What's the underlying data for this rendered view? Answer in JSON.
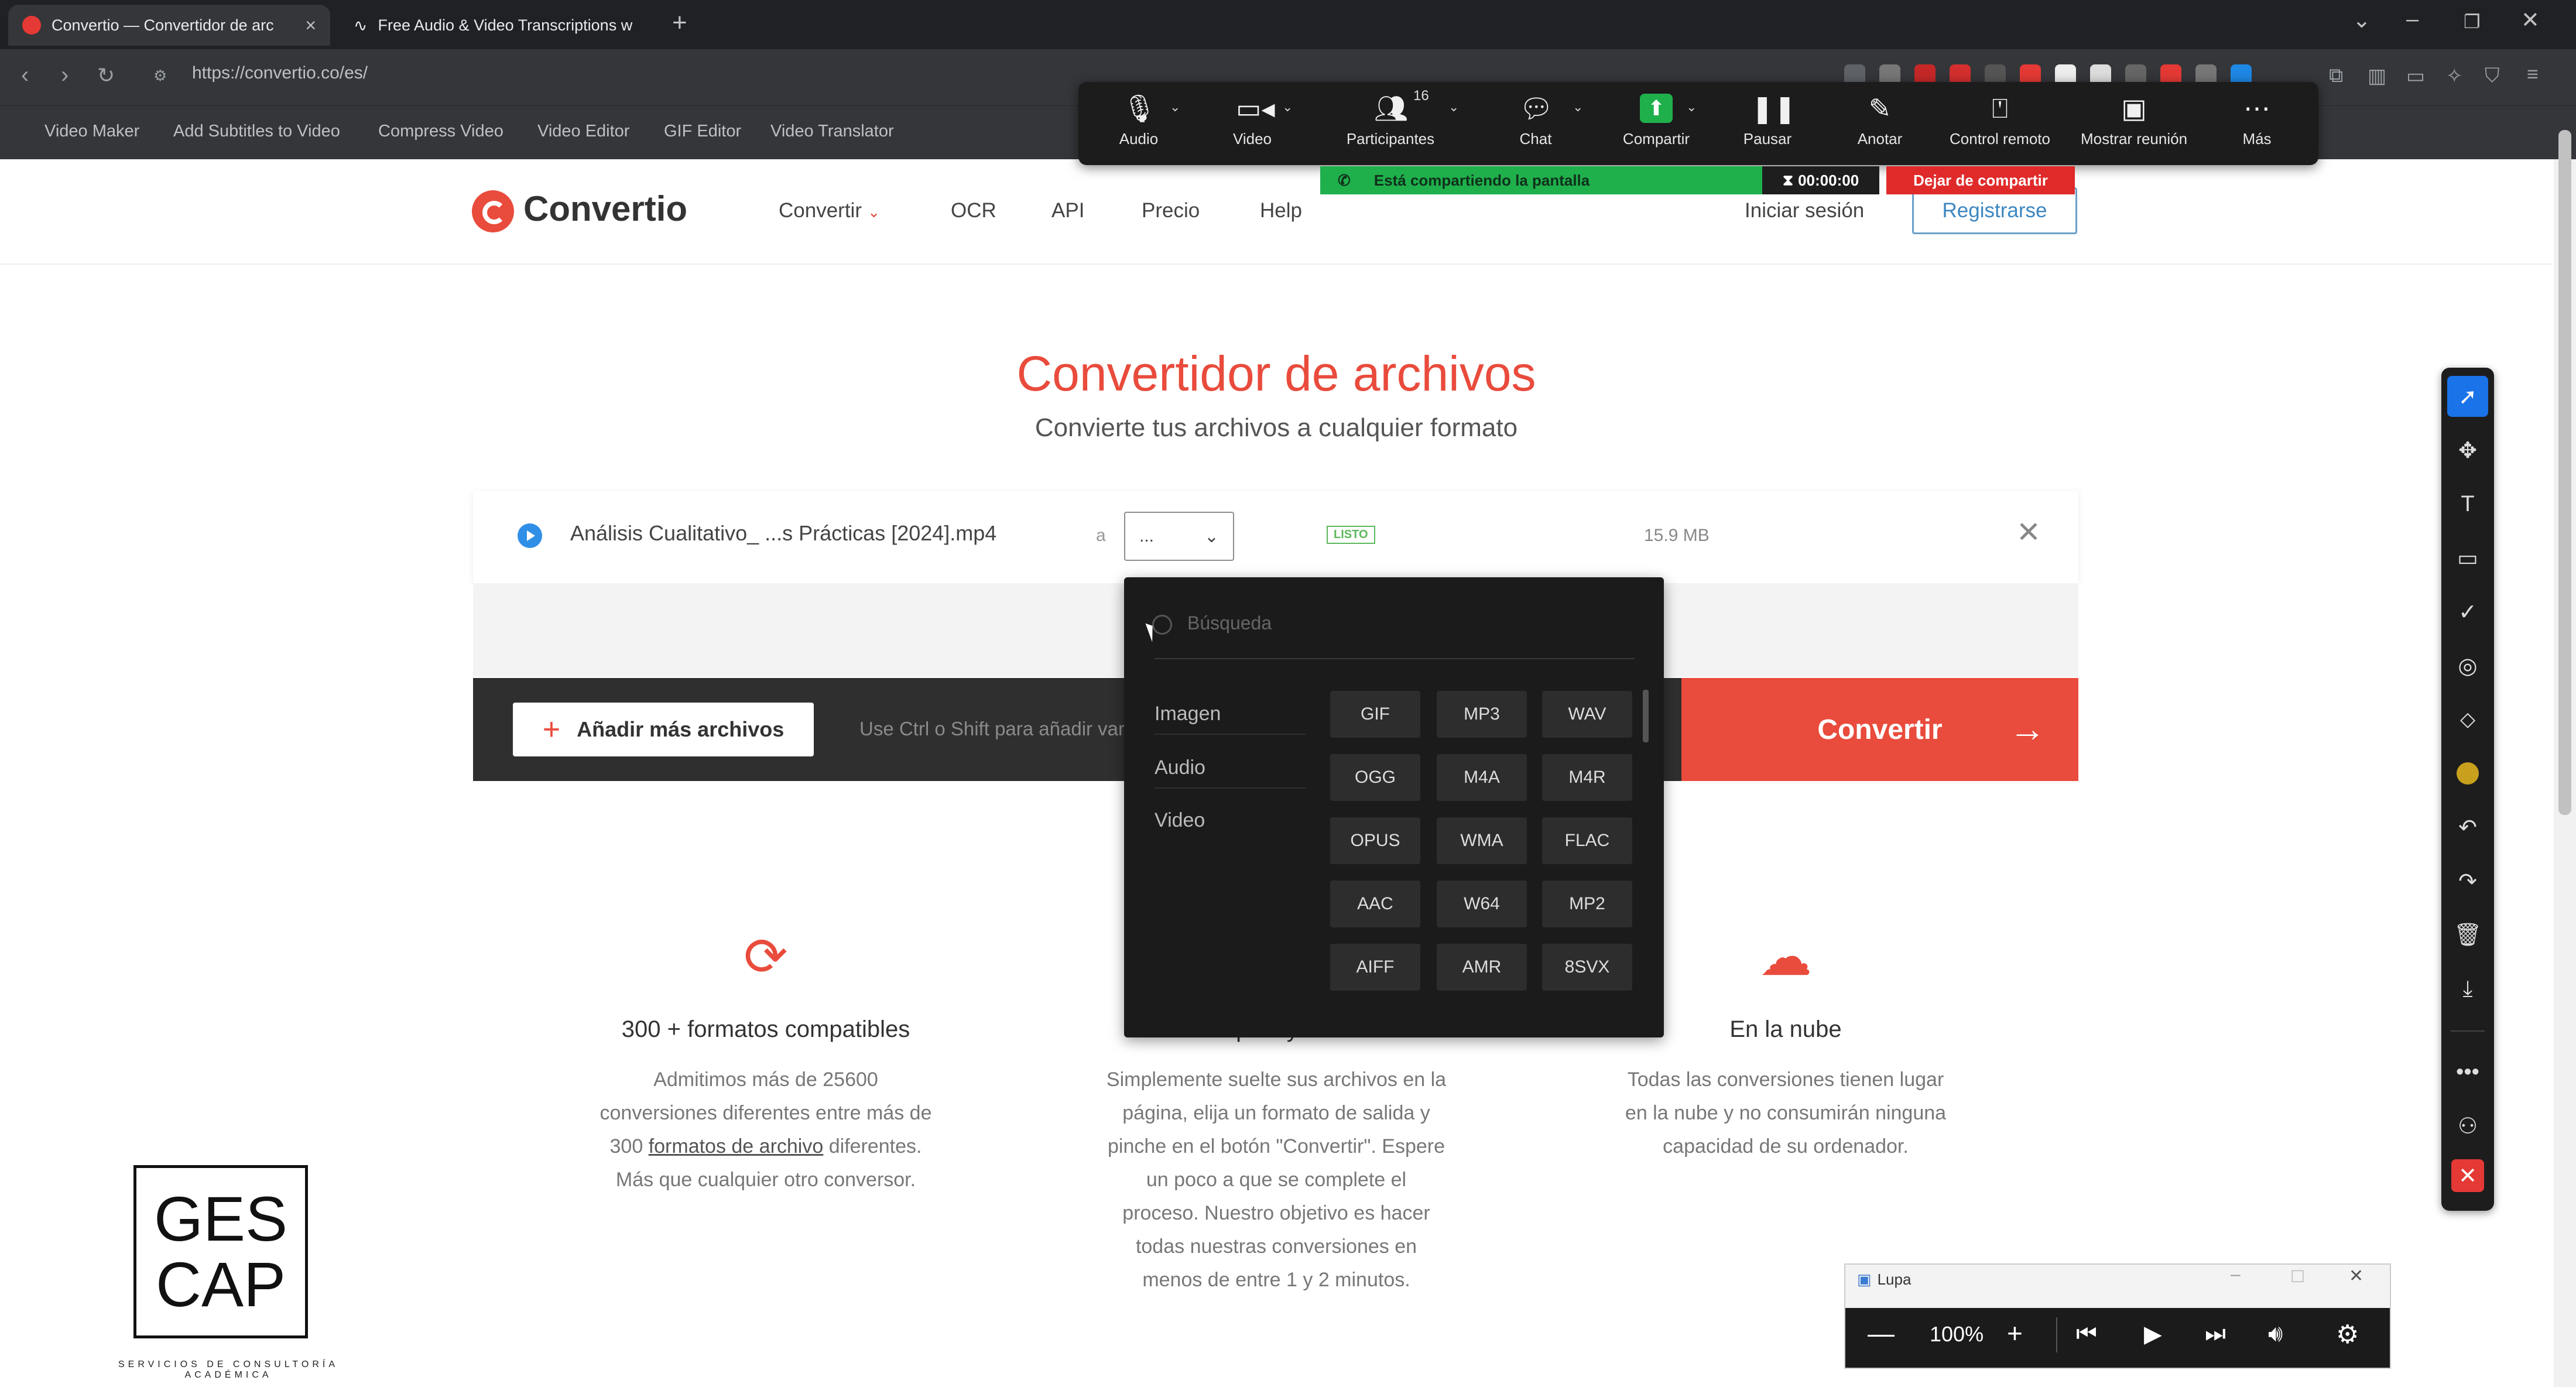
{
  "browser": {
    "tabs": [
      {
        "title": "Convertio — Convertidor de arc"
      },
      {
        "title": "Free Audio & Video Transcriptions w"
      }
    ],
    "url": "https://convertio.co/es/",
    "bookmarks": [
      "Video Maker",
      "Add Subtitles to Video",
      "Compress Video",
      "Video Editor",
      "GIF Editor",
      "Video Translator"
    ]
  },
  "zoom_toolbar": {
    "items": [
      {
        "label": "Audio",
        "icon": "microphone-icon"
      },
      {
        "label": "Video",
        "icon": "camera-icon"
      },
      {
        "label": "Participantes",
        "icon": "participants-icon",
        "badge": "16"
      },
      {
        "label": "Chat",
        "icon": "chat-icon"
      },
      {
        "label": "Compartir",
        "icon": "share-screen-icon"
      },
      {
        "label": "Pausar",
        "icon": "pause-icon"
      },
      {
        "label": "Anotar",
        "icon": "pencil-icon"
      },
      {
        "label": "Control remoto",
        "icon": "mouse-icon"
      },
      {
        "label": "Mostrar reunión",
        "icon": "show-meeting-icon"
      },
      {
        "label": "Más",
        "icon": "more-icon"
      }
    ],
    "sharing_banner": "Está compartiendo la pantalla",
    "timer": "00:00:00",
    "stop_sharing": "Dejar de compartir",
    "colors": {
      "banner": "#1fb04c",
      "stop": "#e02a2a"
    }
  },
  "site": {
    "logo": "Convertio",
    "nav": [
      "Convertir",
      "OCR",
      "API",
      "Precio",
      "Help"
    ],
    "login": "Iniciar sesión",
    "register": "Registrarse",
    "accent": "#e94b3c"
  },
  "main": {
    "title": "Convertidor de archivos",
    "subtitle": "Convierte tus archivos a cualquier formato",
    "file": {
      "name": "Análisis Cualitativo_ ...s Prácticas [2024].mp4",
      "to_label": "a",
      "format_value": "...",
      "status": "LISTO",
      "size": "15.9 MB"
    },
    "add_files": "Añadir más archivos",
    "hint": "Use Ctrl o Shift para añadir var",
    "convert": "Convertir"
  },
  "dropdown": {
    "search_placeholder": "Búsqueda",
    "categories": [
      "Imagen",
      "Audio",
      "Video"
    ],
    "formats": [
      "GIF",
      "MP3",
      "WAV",
      "OGG",
      "M4A",
      "M4R",
      "OPUS",
      "WMA",
      "FLAC",
      "AAC",
      "W64",
      "MP2",
      "AIFF",
      "AMR",
      "8SVX"
    ]
  },
  "features": [
    {
      "title": "300 + formatos compatibles",
      "desc_lines": [
        "Admitimos más de 25600",
        "conversiones diferentes entre más de"
      ],
      "desc_pre": "300 ",
      "desc_link": "formatos de archivo",
      "desc_post": " diferentes.",
      "desc_last": "Más que cualquier otro conversor."
    },
    {
      "title": "Rápido y fácil",
      "desc_lines": [
        "Simplemente suelte sus archivos en la",
        "página, elija un formato de salida y",
        "pinche en el botón \"Convertir\". Espere",
        "un poco a que se complete el",
        "proceso. Nuestro objetivo es hacer",
        "todas nuestras conversiones en",
        "menos de entre 1 y 2 minutos."
      ]
    },
    {
      "title": "En la nube",
      "desc_lines": [
        "Todas las conversiones tienen lugar",
        "en la nube y no consumirán ninguna",
        "capacidad de su ordenador."
      ]
    }
  ],
  "gescap": {
    "line1": "GES",
    "line2": "CAP",
    "sub": "SERVICIOS DE CONSULTORÍA ACADÉMICA"
  },
  "lupa": {
    "title": "Lupa",
    "zoom": "100%"
  }
}
